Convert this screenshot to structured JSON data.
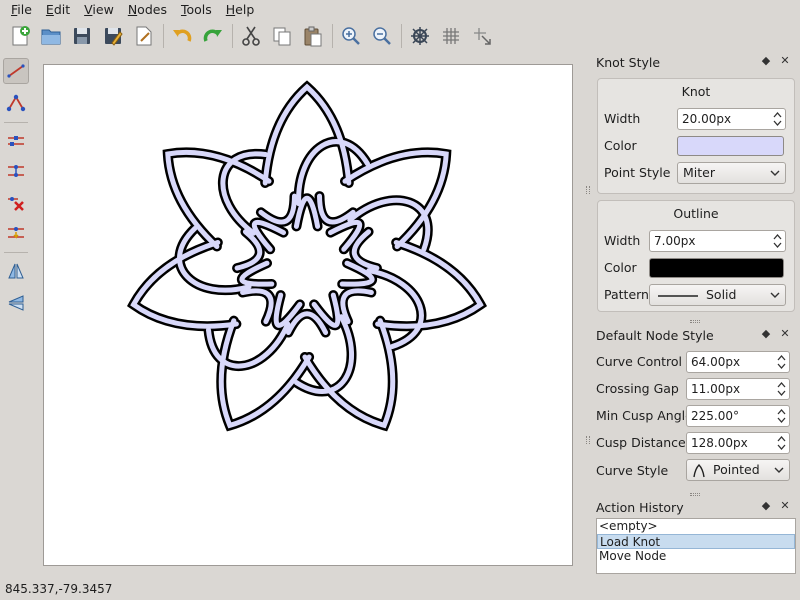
{
  "menu": [
    {
      "u": "F",
      "rest": "ile"
    },
    {
      "u": "E",
      "rest": "dit"
    },
    {
      "u": "V",
      "rest": "iew"
    },
    {
      "u": "N",
      "rest": "odes"
    },
    {
      "u": "T",
      "rest": "ools"
    },
    {
      "u": "H",
      "rest": "elp"
    }
  ],
  "toolbar": {
    "icons": [
      "new-file-icon",
      "open-file-icon",
      "save-icon",
      "save-as-icon",
      "export-icon",
      "undo-icon",
      "redo-icon",
      "cut-icon",
      "copy-icon",
      "paste-icon",
      "zoom-in-icon",
      "zoom-out-icon",
      "knot-icon",
      "grid-icon",
      "move-grid-icon"
    ]
  },
  "tools": {
    "icons": [
      "edge-tool-icon",
      "node-chain-tool-icon",
      "insert-node-icon",
      "link-nodes-icon",
      "delete-node-icon",
      "merge-nodes-icon",
      "flip-horizontal-icon",
      "flip-vertical-icon"
    ]
  },
  "status": {
    "coords": "845.337,-79.3457"
  },
  "knot_style": {
    "title": "Knot Style",
    "knot": {
      "title": "Knot",
      "width_label": "Width",
      "width_value": "20.00px",
      "color_label": "Color",
      "color": "#d8d8fa",
      "point_style_label": "Point Style",
      "point_style_value": "Miter"
    },
    "outline": {
      "title": "Outline",
      "width_label": "Width",
      "width_value": "7.00px",
      "color_label": "Color",
      "color": "#000000",
      "pattern_label": "Pattern",
      "pattern_value": "Solid"
    }
  },
  "node_style": {
    "title": "Default Node Style",
    "curve_control_label": "Curve Control",
    "curve_control_value": "64.00px",
    "crossing_gap_label": "Crossing Gap",
    "crossing_gap_value": "11.00px",
    "min_cusp_angle_label": "Min Cusp Angle",
    "min_cusp_angle_value": "225.00°",
    "cusp_distance_label": "Cusp Distance",
    "cusp_distance_value": "128.00px",
    "curve_style_label": "Curve Style",
    "curve_style_value": "Pointed"
  },
  "history": {
    "title": "Action History",
    "items": [
      "<empty>",
      "Load Knot",
      "Move Node"
    ]
  },
  "colors": {
    "knot_fill": "#d8d8fa",
    "knot_outline": "#000000",
    "selection": "#c8dcef"
  }
}
